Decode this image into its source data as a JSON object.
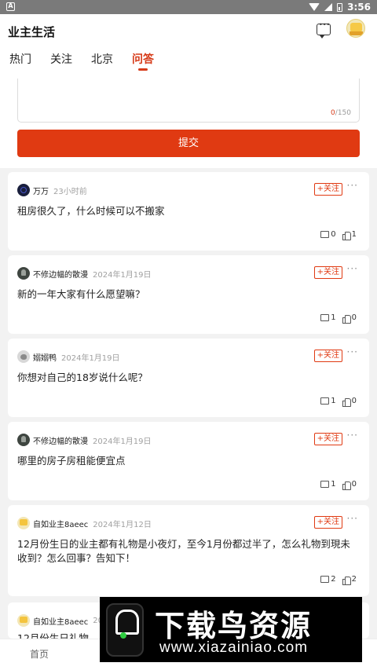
{
  "status_bar": {
    "time": "3:56",
    "left_badge": "A"
  },
  "header": {
    "title": "业主生活",
    "tabs": [
      {
        "label": "热门"
      },
      {
        "label": "关注"
      },
      {
        "label": "北京"
      },
      {
        "label": "问答",
        "active": true
      }
    ]
  },
  "composer": {
    "counter_current": "0",
    "counter_max": "/150",
    "submit_label": "提交"
  },
  "posts": [
    {
      "author": "万万",
      "time": "23小时前",
      "follow_label": "+关注",
      "content": "租房很久了，什么时候可以不搬家",
      "comments": "0",
      "likes": "1"
    },
    {
      "author": "不修边幅的散漫",
      "time": "2024年1月19日",
      "follow_label": "+关注",
      "content": "新的一年大家有什么愿望嘛？",
      "comments": "1",
      "likes": "0"
    },
    {
      "author": "嫋嫋鸭",
      "time": "2024年1月19日",
      "follow_label": "+关注",
      "content": "你想对自己的18岁说什么呢？",
      "comments": "1",
      "likes": "0"
    },
    {
      "author": "不修边幅的散漫",
      "time": "2024年1月19日",
      "follow_label": "+关注",
      "content": "哪里的房子房租能便宜点",
      "comments": "1",
      "likes": "0"
    },
    {
      "author": "自如业主8aeec",
      "time": "2024年1月12日",
      "follow_label": "+关注",
      "content": "12月份生日的业主都有礼物是小夜灯，至今1月份都过半了，怎么礼物到現未收到？怎么回事？告知下！",
      "comments": "2",
      "likes": "2"
    },
    {
      "author": "自如业主8aeec",
      "time": "202",
      "content": "12月份生日礼物"
    }
  ],
  "bottom_nav": {
    "home_label": "首页"
  },
  "watermark": {
    "brand": "下载鸟资源",
    "url": "www.xiazainiao.com"
  }
}
